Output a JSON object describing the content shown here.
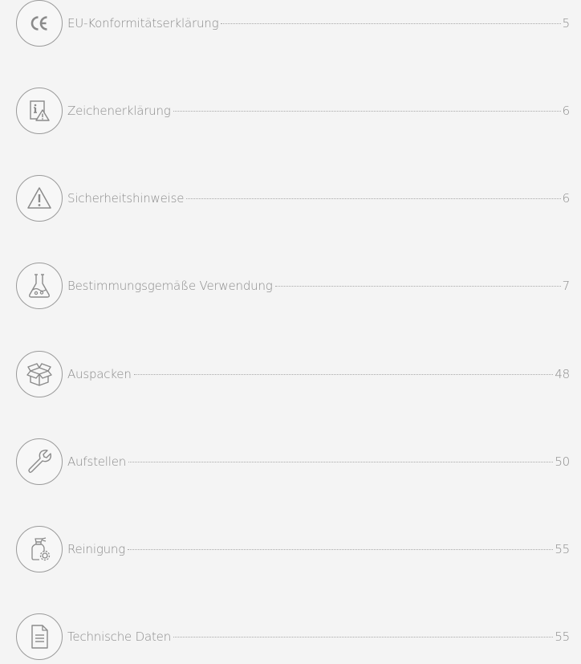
{
  "toc": {
    "entries": [
      {
        "icon": "ce-mark-icon",
        "title": "EU-Konformitätserklärung",
        "page": "5"
      },
      {
        "icon": "info-warning-icon",
        "title": "Zeichenerklärung",
        "page": "6"
      },
      {
        "icon": "warning-triangle-icon",
        "title": "Sicherheitshinweise",
        "page": "6"
      },
      {
        "icon": "lab-flask-icon",
        "title": "Bestimmungsgemäße Verwendung",
        "page": "7"
      },
      {
        "icon": "open-box-icon",
        "title": "Auspacken",
        "page": "48"
      },
      {
        "icon": "wrench-icon",
        "title": "Aufstellen",
        "page": "50"
      },
      {
        "icon": "spray-bottle-gear-icon",
        "title": "Reinigung",
        "page": "55"
      },
      {
        "icon": "document-icon",
        "title": "Technische Daten",
        "page": "55"
      }
    ]
  }
}
